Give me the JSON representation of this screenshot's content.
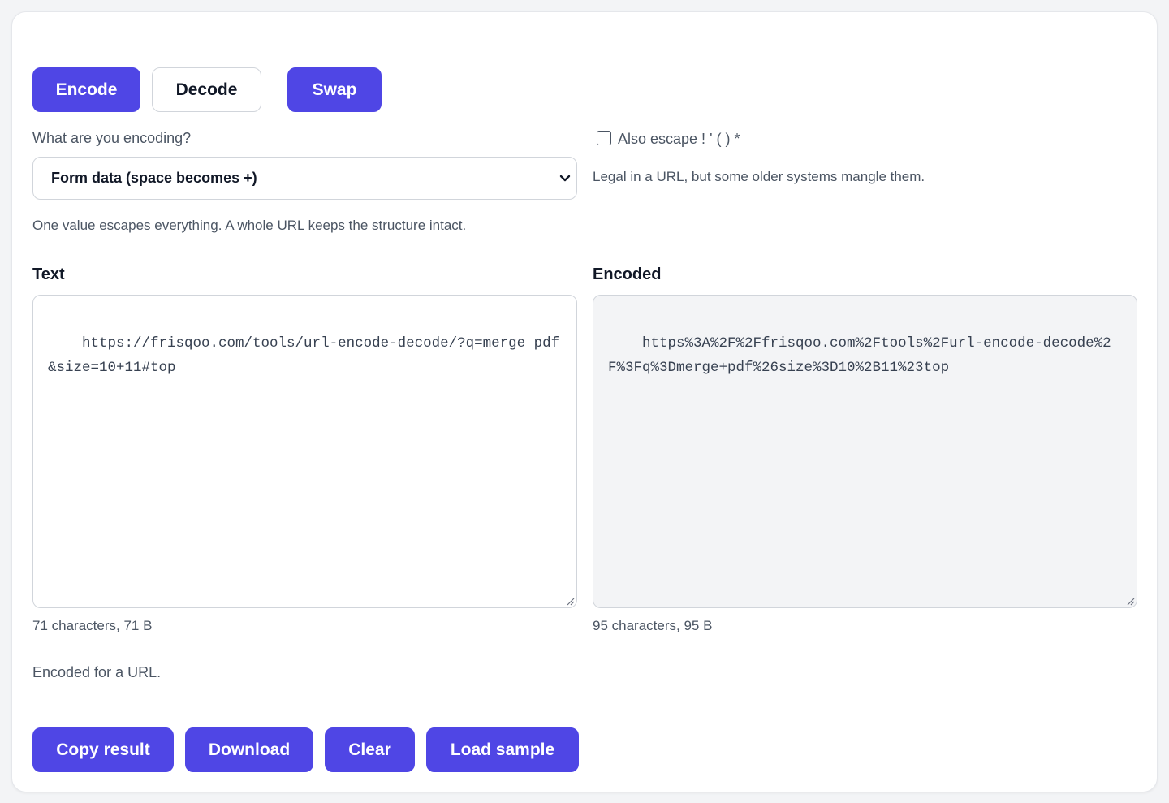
{
  "mode_buttons": {
    "encode": "Encode",
    "decode": "Decode",
    "swap": "Swap"
  },
  "encoding_type": {
    "label": "What are you encoding?",
    "selected": "Form data (space becomes +)",
    "hint": "One value escapes everything. A whole URL keeps the structure intact."
  },
  "escape_option": {
    "label": "Also escape ! ' ( ) *",
    "checked": false,
    "hint": "Legal in a URL, but some older systems mangle them."
  },
  "input": {
    "label": "Text",
    "value": "https://frisqoo.com/tools/url-encode-decode/?q=merge pdf&size=10+11#top",
    "count": "71 characters, 71 B"
  },
  "output": {
    "label": "Encoded",
    "value": "https%3A%2F%2Ffrisqoo.com%2Ftools%2Furl-encode-decode%2F%3Fq%3Dmerge+pdf%26size%3D10%2B11%23top",
    "count": "95 characters, 95 B"
  },
  "status": "Encoded for a URL.",
  "actions": {
    "copy": "Copy result",
    "download": "Download",
    "clear": "Clear",
    "load_sample": "Load sample"
  },
  "colors": {
    "accent": "#4f46e5",
    "background": "#f3f4f6",
    "card": "#ffffff",
    "muted_text": "#4b5563"
  }
}
